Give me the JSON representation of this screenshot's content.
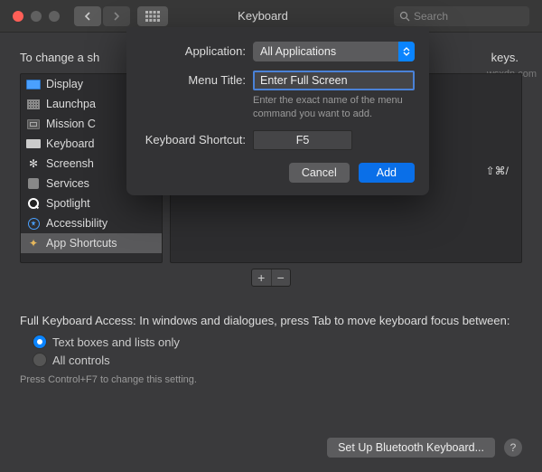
{
  "titlebar": {
    "title": "Keyboard",
    "search_placeholder": "Search"
  },
  "sheet": {
    "application_label": "Application:",
    "application_value": "All Applications",
    "menu_title_label": "Menu Title:",
    "menu_title_value": "Enter Full Screen",
    "menu_title_hint": "Enter the exact name of the menu command you want to add.",
    "shortcut_label": "Keyboard Shortcut:",
    "shortcut_value": "F5",
    "cancel": "Cancel",
    "add": "Add"
  },
  "intro_prefix": "To change a sh",
  "intro_suffix": "keys.",
  "sidebar": {
    "items": [
      {
        "label": "Display"
      },
      {
        "label": "Launchpa"
      },
      {
        "label": "Mission C"
      },
      {
        "label": "Keyboard"
      },
      {
        "label": "Screensh"
      },
      {
        "label": "Services"
      },
      {
        "label": "Spotlight"
      },
      {
        "label": "Accessibility"
      },
      {
        "label": "App Shortcuts"
      }
    ]
  },
  "rightpane": {
    "shortcut_display": "⇧⌘/"
  },
  "add_remove": {
    "plus": "+",
    "minus": "−"
  },
  "fka": {
    "title": "Full Keyboard Access: In windows and dialogues, press Tab to move keyboard focus between:",
    "opt1": "Text boxes and lists only",
    "opt2": "All controls",
    "hint": "Press Control+F7 to change this setting."
  },
  "footer": {
    "bluetooth": "Set Up Bluetooth Keyboard...",
    "help": "?"
  },
  "watermark": "wsxdn.com"
}
